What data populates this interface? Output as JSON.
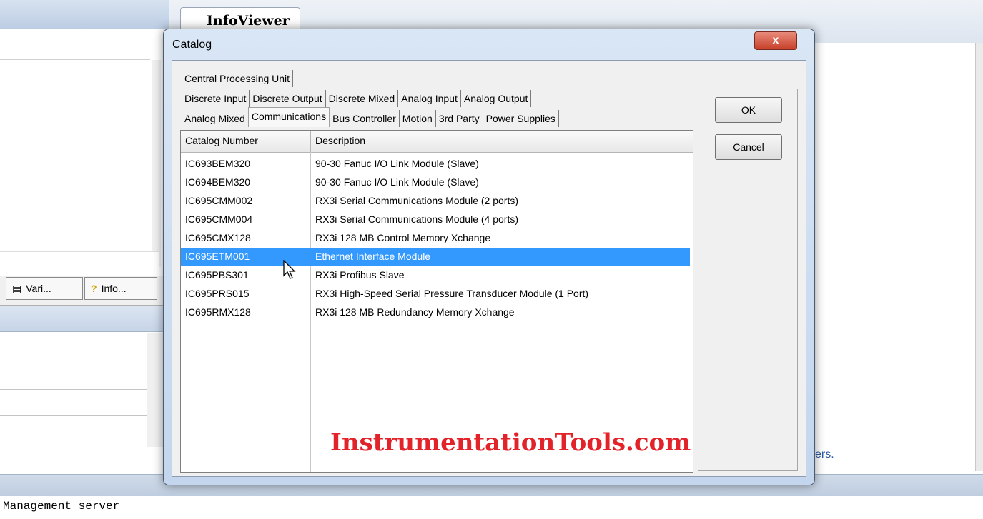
{
  "background": {
    "infoviewer_tab": "InfoViewer",
    "pane_tabs": [
      {
        "label": "Vari..."
      },
      {
        "label": "Info..."
      }
    ],
    "status_text": "ers.",
    "console_text": "Management server"
  },
  "dialog": {
    "title": "Catalog",
    "close_label": "x",
    "ok_label": "OK",
    "cancel_label": "Cancel",
    "tabs_row1": [
      "Central Processing Unit"
    ],
    "tabs_row2": [
      "Discrete Input",
      "Discrete Output",
      "Discrete Mixed",
      "Analog Input",
      "Analog Output"
    ],
    "tabs_row3": [
      "Analog Mixed",
      "Communications",
      "Bus Controller",
      "Motion",
      "3rd Party",
      "Power Supplies"
    ],
    "selected_tab": "Communications",
    "columns": [
      "Catalog Number",
      "Description"
    ],
    "rows": [
      {
        "num": "IC693BEM320",
        "desc": "90-30 Fanuc I/O Link Module (Slave)"
      },
      {
        "num": "IC694BEM320",
        "desc": "90-30 Fanuc I/O Link Module (Slave)"
      },
      {
        "num": "IC695CMM002",
        "desc": "RX3i Serial Communications Module (2 ports)"
      },
      {
        "num": "IC695CMM004",
        "desc": "RX3i Serial Communications Module (4 ports)"
      },
      {
        "num": "IC695CMX128",
        "desc": "RX3i 128 MB Control Memory Xchange"
      },
      {
        "num": "IC695ETM001",
        "desc": "Ethernet Interface Module"
      },
      {
        "num": "IC695PBS301",
        "desc": "RX3i Profibus Slave"
      },
      {
        "num": "IC695PRS015",
        "desc": "RX3i High-Speed Serial Pressure Transducer Module (1 Port)"
      },
      {
        "num": "IC695RMX128",
        "desc": "RX3i 128 MB Redundancy Memory Xchange"
      }
    ],
    "selected_row": 5
  },
  "watermark": "InstrumentationTools.com",
  "colors": {
    "selection": "#3399ff",
    "watermark": "#e3232a",
    "close_button": "#c7402a"
  }
}
